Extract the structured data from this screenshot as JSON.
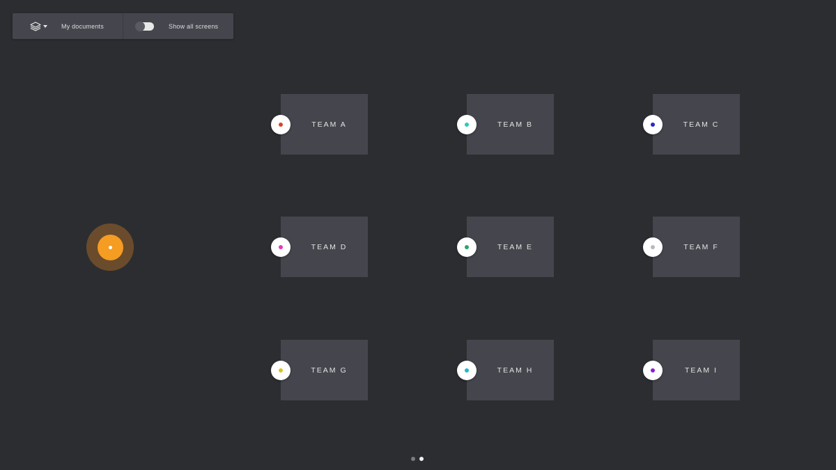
{
  "toolbar": {
    "layers_icon": "layers-icon",
    "my_documents": "My documents",
    "show_all_screens": "Show all screens",
    "toggle_on": false
  },
  "orange_node": {
    "color": "#f59c22"
  },
  "teams": [
    {
      "label": "TEAM A",
      "dot_color": "#d6452f"
    },
    {
      "label": "TEAM B",
      "dot_color": "#2ec9c2"
    },
    {
      "label": "TEAM C",
      "dot_color": "#2b28c9"
    },
    {
      "label": "TEAM D",
      "dot_color": "#e23bb8"
    },
    {
      "label": "TEAM E",
      "dot_color": "#2aa66a"
    },
    {
      "label": "TEAM F",
      "dot_color": "#b9b9b9"
    },
    {
      "label": "TEAM G",
      "dot_color": "#d8c21f"
    },
    {
      "label": "TEAM H",
      "dot_color": "#20b9cc"
    },
    {
      "label": "TEAM I",
      "dot_color": "#8a1fd1"
    }
  ],
  "pagination": {
    "count": 2,
    "active": 1
  }
}
